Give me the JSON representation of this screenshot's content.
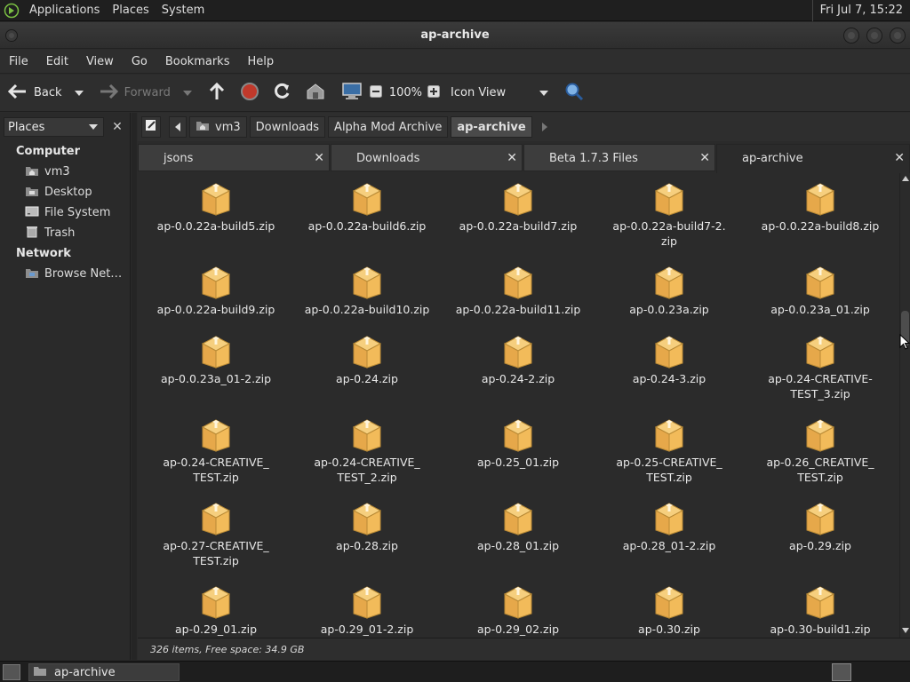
{
  "top_panel": {
    "menus": [
      "Applications",
      "Places",
      "System"
    ],
    "clock": "Fri Jul  7, 15:22"
  },
  "window": {
    "title": "ap-archive"
  },
  "menubar": [
    "File",
    "Edit",
    "View",
    "Go",
    "Bookmarks",
    "Help"
  ],
  "toolbar": {
    "back": "Back",
    "forward": "Forward",
    "zoom": "100%",
    "view_mode": "Icon View"
  },
  "sidebar": {
    "selector": "Places",
    "groups": [
      {
        "label": "Computer",
        "items": [
          {
            "label": "vm3",
            "icon": "home-folder-icon"
          },
          {
            "label": "Desktop",
            "icon": "desktop-folder-icon"
          },
          {
            "label": "File System",
            "icon": "drive-icon"
          },
          {
            "label": "Trash",
            "icon": "trash-icon"
          }
        ]
      },
      {
        "label": "Network",
        "items": [
          {
            "label": "Browse Net…",
            "icon": "network-icon"
          }
        ]
      }
    ]
  },
  "pathbar": [
    "vm3",
    "Downloads",
    "Alpha Mod Archive",
    "ap-archive"
  ],
  "tabs": [
    "jsons",
    "Downloads",
    "Beta 1.7.3 Files",
    "ap-archive"
  ],
  "files": [
    "ap-0.0.22a-build5.zip",
    "ap-0.0.22a-build6.zip",
    "ap-0.0.22a-build7.zip",
    "ap-0.0.22a-build7-2.\nzip",
    "ap-0.0.22a-build8.zip",
    "ap-0.0.22a-build9.zip",
    "ap-0.0.22a-build10.zip",
    "ap-0.0.22a-build11.zip",
    "ap-0.0.23a.zip",
    "ap-0.0.23a_01.zip",
    "ap-0.0.23a_01-2.zip",
    "ap-0.24.zip",
    "ap-0.24-2.zip",
    "ap-0.24-3.zip",
    "ap-0.24-CREATIVE-\nTEST_3.zip",
    "ap-0.24-CREATIVE_\nTEST.zip",
    "ap-0.24-CREATIVE_\nTEST_2.zip",
    "ap-0.25_01.zip",
    "ap-0.25-CREATIVE_\nTEST.zip",
    "ap-0.26_CREATIVE_\nTEST.zip",
    "ap-0.27-CREATIVE_\nTEST.zip",
    "ap-0.28.zip",
    "ap-0.28_01.zip",
    "ap-0.28_01-2.zip",
    "ap-0.29.zip",
    "ap-0.29_01.zip",
    "ap-0.29_01-2.zip",
    "ap-0.29_02.zip",
    "ap-0.30.zip",
    "ap-0.30-build1.zip"
  ],
  "status": "326 items, Free space: 34.9 GB",
  "taskbar": {
    "window_item": "ap-archive"
  }
}
